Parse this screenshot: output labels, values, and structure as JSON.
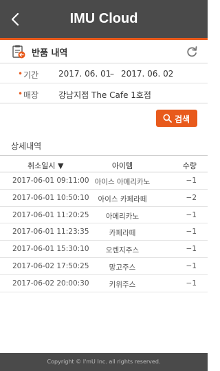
{
  "header": {
    "title": "IMU Cloud",
    "back_icon": "chevron-left-icon"
  },
  "section": {
    "title": "반품 내역",
    "icon": "document-return-icon",
    "refresh_icon": "refresh-icon"
  },
  "filters": {
    "period_label": "기간",
    "period_from": "2017. 06. 01",
    "period_separator": "–",
    "period_to": "2017. 06. 02",
    "store_label": "매장",
    "store_value": "강남지점 The Cafe 1호점"
  },
  "search_button": {
    "label": "검색",
    "icon": "search-icon"
  },
  "details": {
    "label": "상세내역",
    "columns": [
      "취소일시 ▼",
      "아이템",
      "수량"
    ],
    "rows": [
      {
        "time": "2017-06-01 09:11:00",
        "item": "아이스 아메리카노",
        "qty": "−1"
      },
      {
        "time": "2017-06-01 10:50:10",
        "item": "아이스 카페라떼",
        "qty": "−2"
      },
      {
        "time": "2017-06-01 11:20:25",
        "item": "아메리카노",
        "qty": "−1"
      },
      {
        "time": "2017-06-01 11:23:35",
        "item": "카페라떼",
        "qty": "−1"
      },
      {
        "time": "2017-06-01 15:30:10",
        "item": "오렌지주스",
        "qty": "−1"
      },
      {
        "time": "2017-06-02 17:50:25",
        "item": "망고주스",
        "qty": "−1"
      },
      {
        "time": "2017-06-02 20:00:30",
        "item": "키위주스",
        "qty": "−1"
      }
    ]
  },
  "footer": {
    "copyright": "Copyright © I'mU Inc. all rights reserved."
  },
  "colors": {
    "header_bg": "#4a4a4a",
    "accent": "#e85a1c"
  }
}
